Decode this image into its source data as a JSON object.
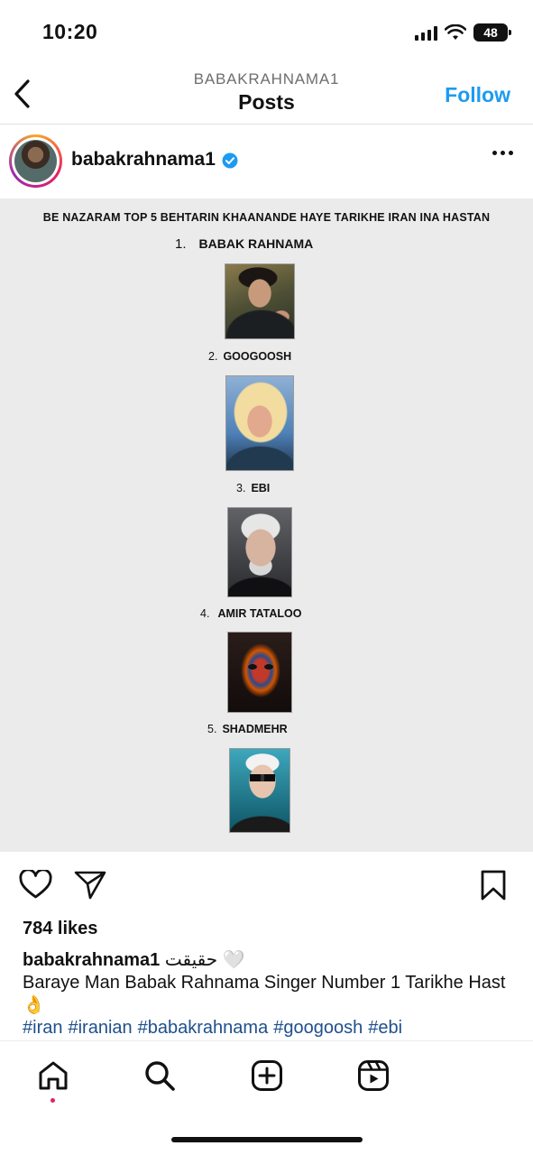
{
  "status_bar": {
    "time": "10:20",
    "battery": "48"
  },
  "header": {
    "username_caps": "BABAKRAHNAMA1",
    "title": "Posts",
    "follow_label": "Follow"
  },
  "post": {
    "author": "babakrahnama1",
    "headline": "BE NAZARAM TOP 5 BEHTARIN KHAANANDE HAYE  TARIKHE IRAN INA HASTAN",
    "ranking": [
      {
        "rank": "1.",
        "name": "BABAK RAHNAMA"
      },
      {
        "rank": "2.",
        "name": "GOOGOOSH"
      },
      {
        "rank": "3.",
        "name": "EBI"
      },
      {
        "rank": "4.",
        "name": "AMIR TATALOO"
      },
      {
        "rank": "5.",
        "name": "SHADMEHR"
      }
    ],
    "likes": "784 likes",
    "caption_user": "babakrahnama1",
    "caption_farsi": "حقیقت",
    "caption_heart": "🤍",
    "caption_text": "Baraye Man Babak Rahnama Singer Number 1 Tarikhe Hast",
    "caption_emoji": "👌",
    "hashtags": [
      "#iran",
      "#iranian",
      "#babakrahnama",
      "#googoosh",
      "#ebi"
    ]
  },
  "icons": {
    "back": "chevron-left-icon",
    "verified": "verified-badge-icon",
    "more": "more-horizontal-icon",
    "like": "heart-icon",
    "share": "send-icon",
    "save": "bookmark-icon",
    "home": "home-icon",
    "search": "search-icon",
    "create": "plus-square-icon",
    "reels": "reels-icon"
  },
  "colors": {
    "accent": "#1d9bf0",
    "hashtag": "#1f4f8c",
    "post_bg": "#ebebeb",
    "notification_dot": "#e0245e"
  }
}
